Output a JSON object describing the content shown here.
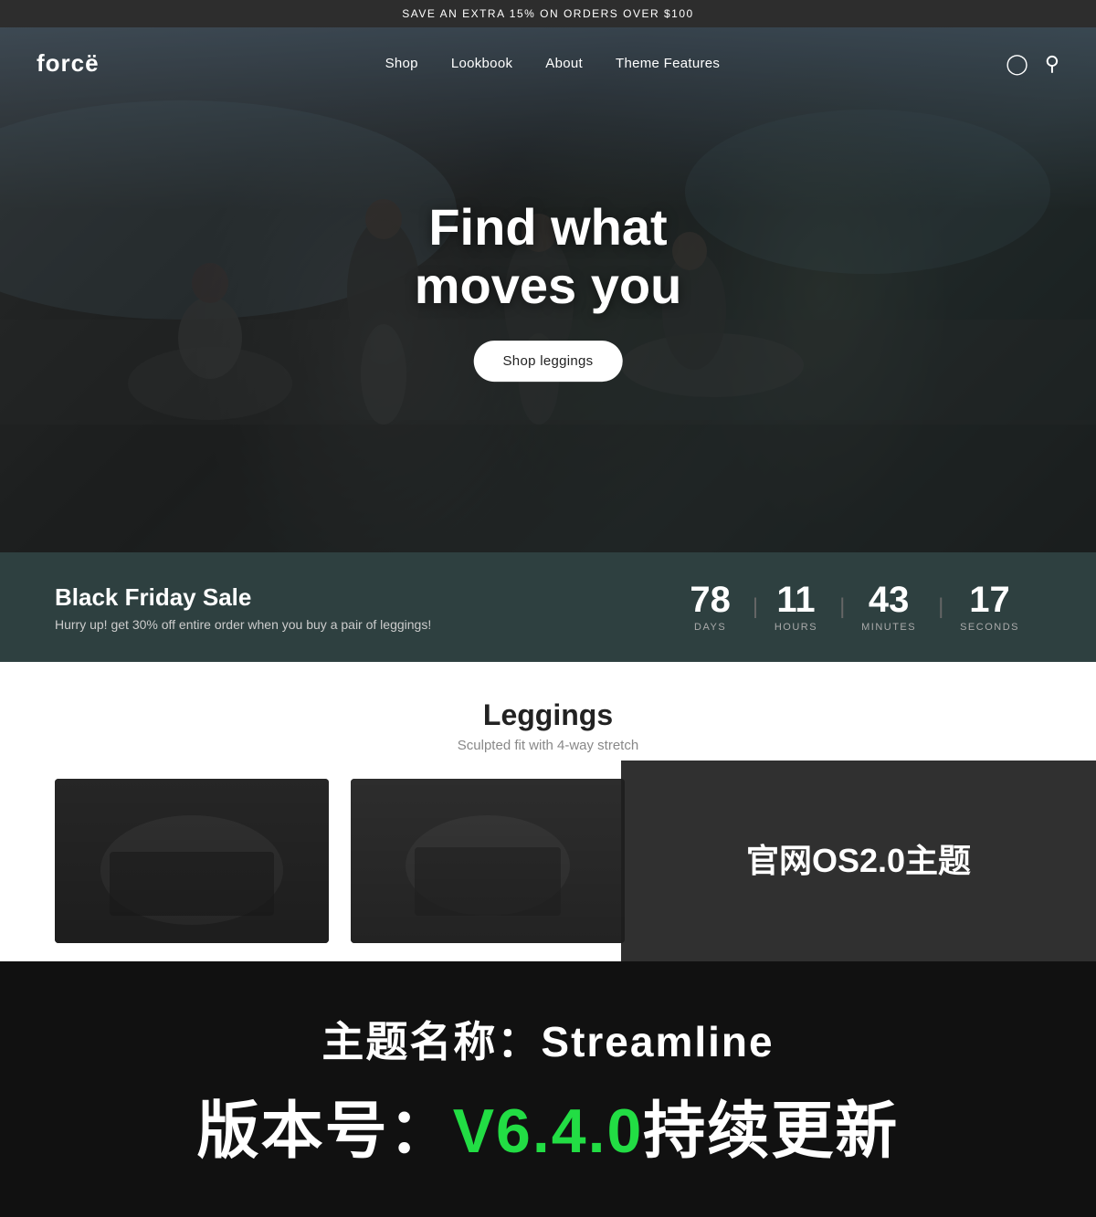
{
  "announcement": {
    "text": "SAVE AN EXTRA 15% ON ORDERS OVER $100"
  },
  "nav": {
    "logo": "forcë",
    "items": [
      {
        "label": "Shop"
      },
      {
        "label": "Lookbook"
      },
      {
        "label": "About"
      },
      {
        "label": "Theme Features"
      }
    ]
  },
  "hero": {
    "title_line1": "Find what",
    "title_line2": "moves you",
    "cta_label": "Shop leggings"
  },
  "countdown": {
    "title": "Black Friday Sale",
    "subtitle": "Hurry up! get 30% off entire order when you buy a pair of leggings!",
    "units": [
      {
        "value": "78",
        "label": "DAYS"
      },
      {
        "value": "11",
        "label": "HOURS"
      },
      {
        "value": "43",
        "label": "MINUTES"
      },
      {
        "value": "17",
        "label": "SECONDS"
      }
    ]
  },
  "products": {
    "title": "Leggings",
    "subtitle": "Sculpted fit with 4-way stretch"
  },
  "watermark": {
    "line1": "官网OS2.0主题"
  },
  "bottom": {
    "line1": "主题名称：Streamline",
    "line2_prefix": "版本号：",
    "line2_version": "V6.4.0",
    "line2_suffix": "持续更新"
  }
}
